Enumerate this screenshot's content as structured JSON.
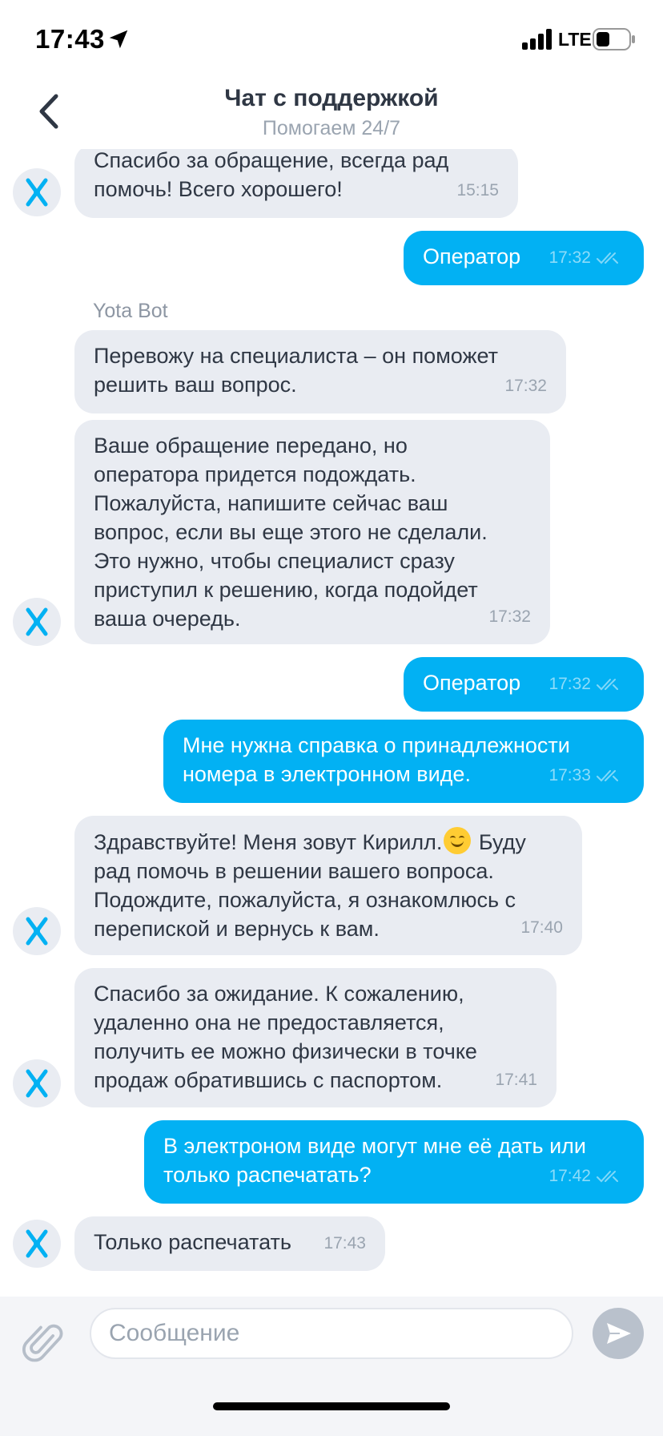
{
  "status_bar": {
    "time": "17:43",
    "network": "LTE"
  },
  "header": {
    "title": "Чат с поддержкой",
    "subtitle": "Помогаем 24/7"
  },
  "colors": {
    "outgoing_bubble": "#02b1f3",
    "incoming_bubble": "#e9ecf2",
    "brand_icon": "#02b1f3"
  },
  "messages": [
    {
      "direction": "in",
      "text": "Спасибо за обращение, всегда рад\nпомочь! Всего хорошего!",
      "time": "15:15"
    },
    {
      "direction": "out",
      "text": "Оператор",
      "time": "17:32"
    },
    {
      "direction": "in",
      "sender": "Yota Bot",
      "text": "Перевожу на специалиста – он поможет\nрешить ваш вопрос.",
      "time": "17:32"
    },
    {
      "direction": "in",
      "text": "Ваше обращение передано, но\nоператора придется подождать.\nПожалуйста, напишите сейчас ваш\nвопрос, если вы еще этого не сделали.\nЭто нужно, чтобы специалист сразу\nприступил к решению, когда подойдет\nваша очередь.",
      "time": "17:32"
    },
    {
      "direction": "out",
      "text": "Оператор",
      "time": "17:32"
    },
    {
      "direction": "out",
      "text": "Мне нужна справка о принадлежности\nномера в электронном виде.",
      "time": "17:33"
    },
    {
      "direction": "in",
      "text_before_emoji": "Здравствуйте! Меня зовут Кирилл.",
      "emoji": "smiling-face",
      "text_after_emoji": " Буду\nрад помочь в решении вашего вопроса.\nПодождите, пожалуйста, я ознакомлюсь с\nперепиской и вернусь к вам.",
      "time": "17:40"
    },
    {
      "direction": "in",
      "text": "Спасибо за ожидание. К сожалению,\nудаленно она не предоставляется,\nполучить ее можно физически в точке\nпродаж обратившись с паспортом.",
      "time": "17:41"
    },
    {
      "direction": "out",
      "text": "В электроном виде могут мне её дать или\nтолько распечатать?",
      "time": "17:42"
    },
    {
      "direction": "in",
      "text": "Только распечатать",
      "time": "17:43"
    }
  ],
  "composer": {
    "placeholder": "Сообщение"
  },
  "icons": {
    "back": "chevron-left-icon",
    "attach": "paperclip-icon",
    "send": "send-arrow-icon",
    "avatar": "yota-logo-icon",
    "read_status": "double-check-icon"
  }
}
